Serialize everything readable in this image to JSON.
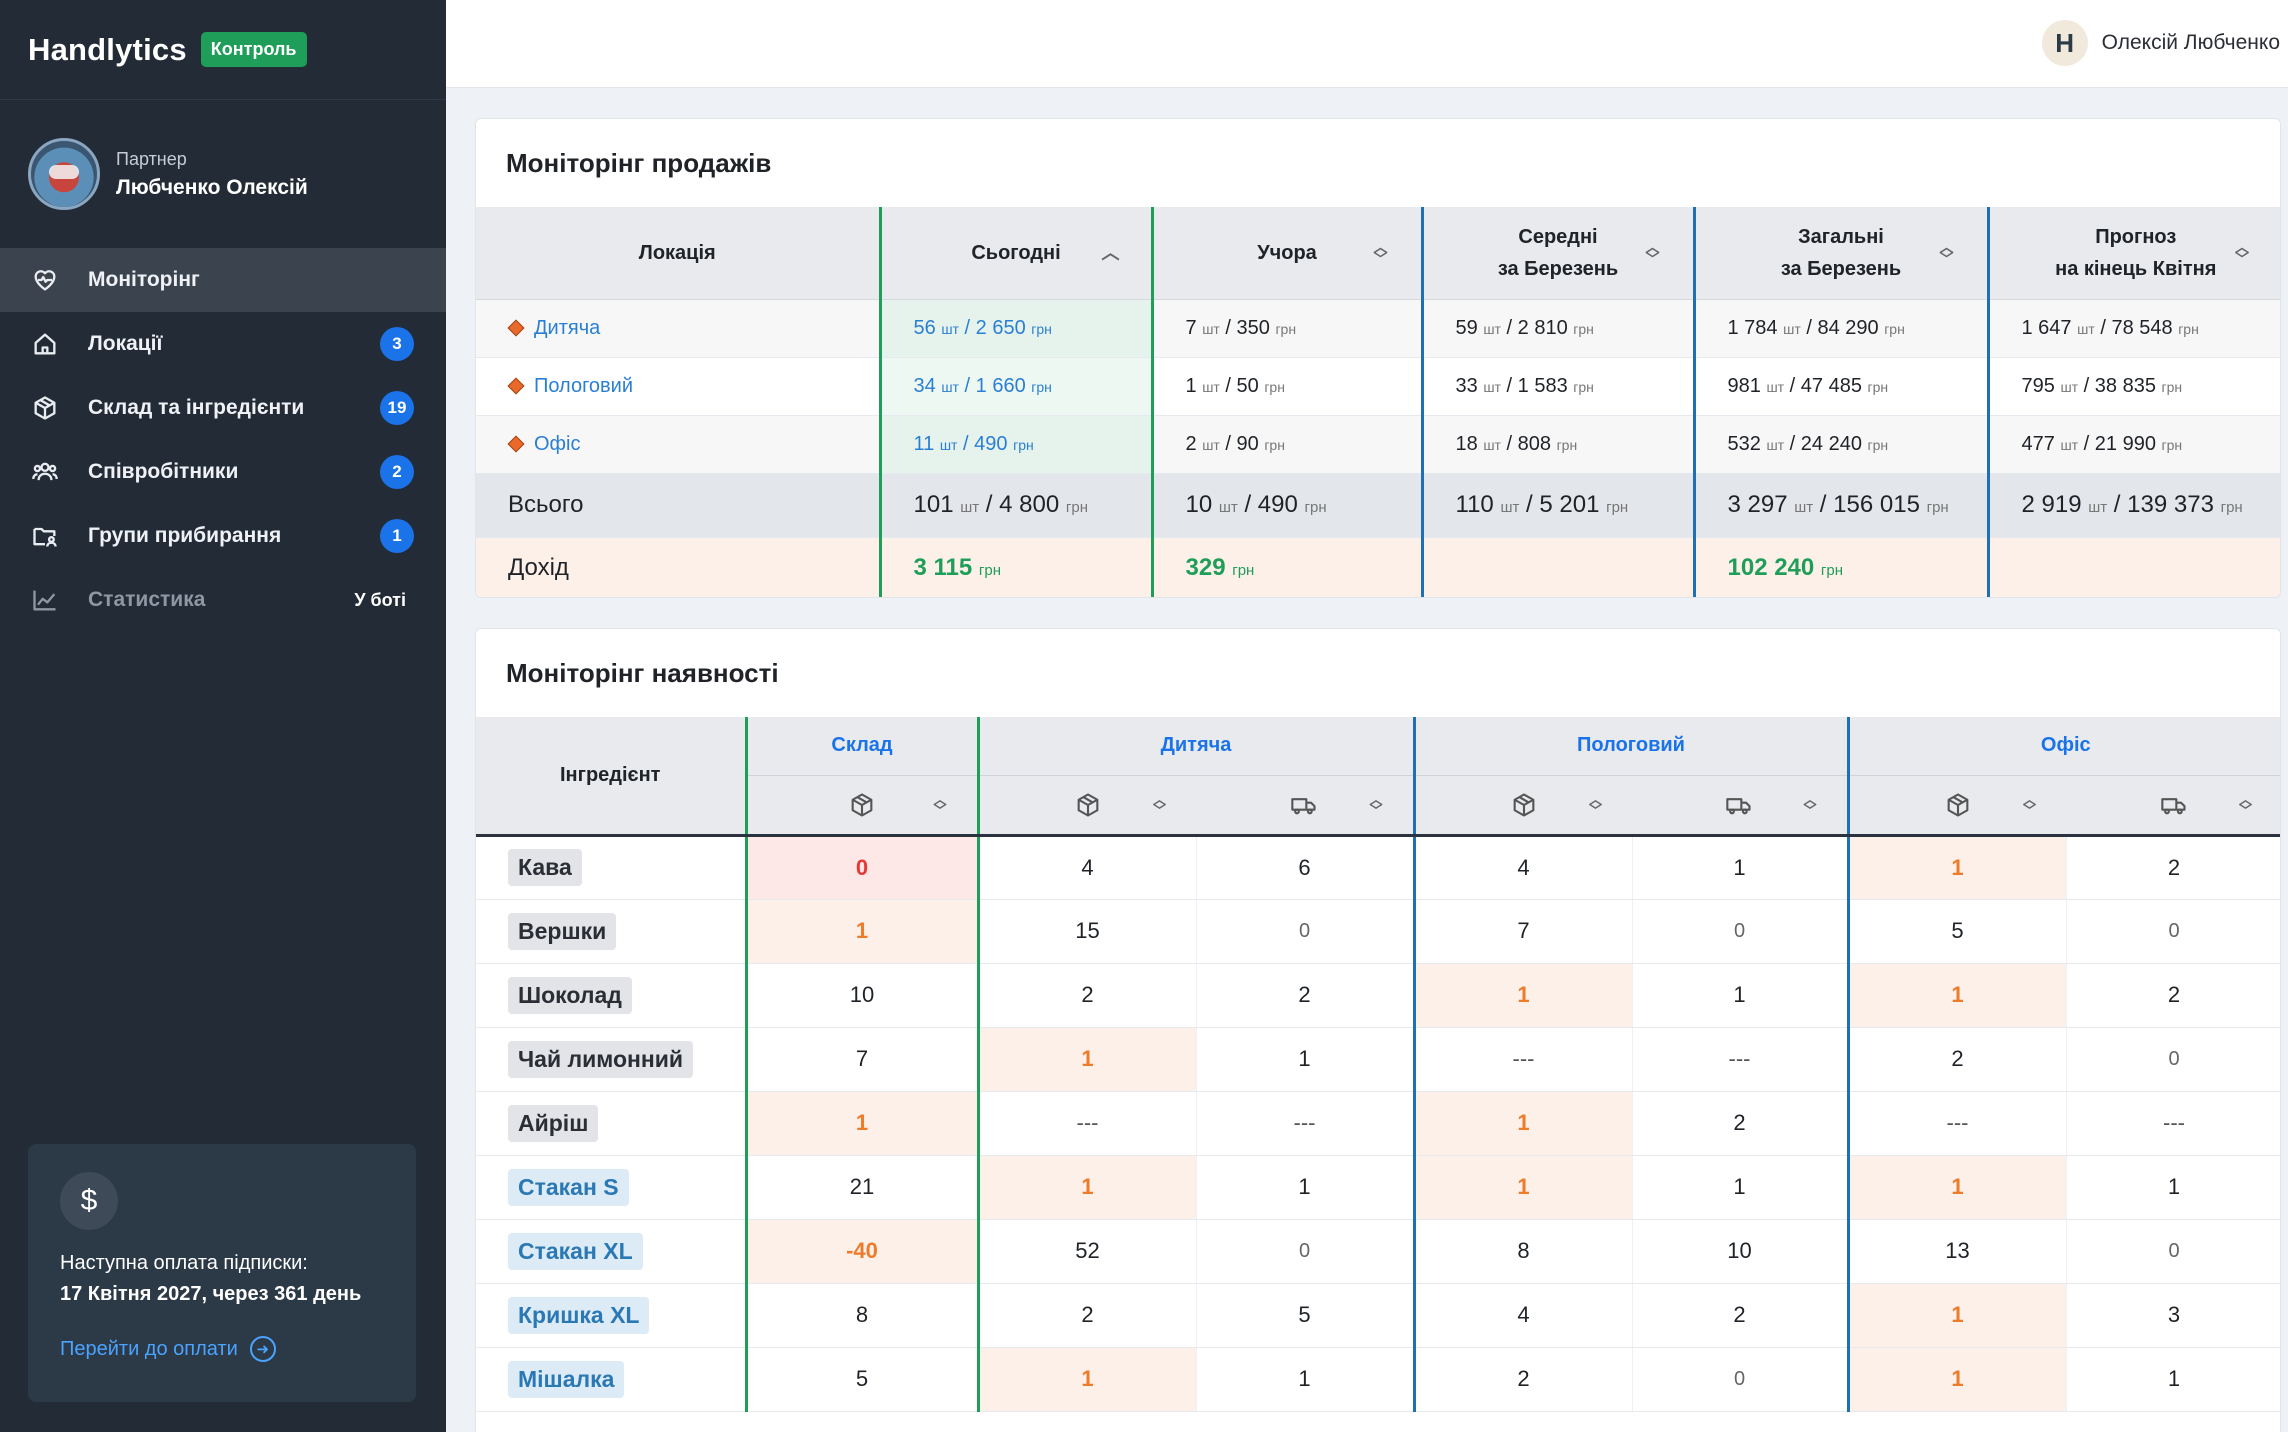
{
  "brand": {
    "name": "Handlytics",
    "badge": "Контроль"
  },
  "profile": {
    "role": "Партнер",
    "name": "Любченко Олексій"
  },
  "nav": [
    {
      "label": "Моніторінг",
      "icon": "heart-pulse-icon",
      "badge": "",
      "active": true
    },
    {
      "label": "Локації",
      "icon": "home-icon",
      "badge": "3"
    },
    {
      "label": "Склад та інгредієнти",
      "icon": "box-icon",
      "badge": "19"
    },
    {
      "label": "Співробітники",
      "icon": "users-icon",
      "badge": "2"
    },
    {
      "label": "Групи прибирання",
      "icon": "folder-user-icon",
      "badge": "1"
    },
    {
      "label": "Статистика",
      "icon": "chart-line-icon",
      "tag": "У боті"
    }
  ],
  "payment": {
    "icon": "$",
    "line1": "Наступна оплата підписки:",
    "line2": "17 Квітня 2027, через 361 день",
    "link": "Перейти до оплати"
  },
  "user": {
    "logo": "H",
    "name": "Олексій Любченко"
  },
  "sales": {
    "title": "Моніторінг продажів",
    "headers": {
      "location": "Локація",
      "today": "Сьогодні",
      "yesterday": "Учора",
      "avg_l1": "Середні",
      "avg_l2": "за Березень",
      "total_l1": "Загальні",
      "total_l2": "за Березень",
      "forecast_l1": "Прогноз",
      "forecast_l2": "на кінець Квітня"
    },
    "unit_pcs": "шт",
    "unit_uah": "грн",
    "rows": [
      {
        "name": "Дитяча",
        "today": [
          "56",
          "2 650"
        ],
        "yesterday": [
          "7",
          "350"
        ],
        "avg": [
          "59",
          "2 810"
        ],
        "total": [
          "1 784",
          "84 290"
        ],
        "forecast": [
          "1 647",
          "78 548"
        ]
      },
      {
        "name": "Пологовий",
        "today": [
          "34",
          "1 660"
        ],
        "yesterday": [
          "1",
          "50"
        ],
        "avg": [
          "33",
          "1 583"
        ],
        "total": [
          "981",
          "47 485"
        ],
        "forecast": [
          "795",
          "38 835"
        ]
      },
      {
        "name": "Офіс",
        "today": [
          "11",
          "490"
        ],
        "yesterday": [
          "2",
          "90"
        ],
        "avg": [
          "18",
          "808"
        ],
        "total": [
          "532",
          "24 240"
        ],
        "forecast": [
          "477",
          "21 990"
        ]
      }
    ],
    "total": {
      "label": "Всього",
      "today": [
        "101",
        "4 800"
      ],
      "yesterday": [
        "10",
        "490"
      ],
      "avg": [
        "110",
        "5 201"
      ],
      "total": [
        "3 297",
        "156 015"
      ],
      "forecast": [
        "2 919",
        "139 373"
      ]
    },
    "income": {
      "label": "Дохід",
      "today": "3 115",
      "yesterday": "329",
      "total": "102 240"
    }
  },
  "stock": {
    "title": "Моніторінг наявності",
    "ingredient_header": "Інгредієнт",
    "groups": [
      "Склад",
      "Дитяча",
      "Пологовий",
      "Офіс"
    ],
    "rows": [
      {
        "name": "Кава",
        "chip": "gray",
        "cells": [
          "0",
          "4",
          "6",
          "4",
          "1",
          "1",
          "2"
        ],
        "state": [
          "bad",
          "",
          "",
          "",
          "",
          "warn",
          ""
        ]
      },
      {
        "name": "Вершки",
        "chip": "gray",
        "cells": [
          "1",
          "15",
          "0",
          "7",
          "0",
          "5",
          "0"
        ],
        "state": [
          "warn",
          "",
          "zero",
          "",
          "zero",
          "",
          "zero"
        ]
      },
      {
        "name": "Шоколад",
        "chip": "gray",
        "cells": [
          "10",
          "2",
          "2",
          "1",
          "1",
          "1",
          "2"
        ],
        "state": [
          "",
          "",
          "",
          "warn",
          "",
          "warn",
          ""
        ]
      },
      {
        "name": "Чай лимонний",
        "chip": "gray",
        "cells": [
          "7",
          "1",
          "1",
          "---",
          "---",
          "2",
          "0"
        ],
        "state": [
          "",
          "warn",
          "",
          "dash",
          "dash",
          "",
          "zero"
        ]
      },
      {
        "name": "Айріш",
        "chip": "gray",
        "cells": [
          "1",
          "---",
          "---",
          "1",
          "2",
          "---",
          "---"
        ],
        "state": [
          "warn",
          "dash",
          "dash",
          "warn",
          "",
          "dash",
          "dash"
        ]
      },
      {
        "name": "Стакан S",
        "chip": "blue",
        "cells": [
          "21",
          "1",
          "1",
          "1",
          "1",
          "1",
          "1"
        ],
        "state": [
          "",
          "warn",
          "",
          "warn",
          "",
          "warn",
          ""
        ]
      },
      {
        "name": "Стакан XL",
        "chip": "blue",
        "cells": [
          "-40",
          "52",
          "0",
          "8",
          "10",
          "13",
          "0"
        ],
        "state": [
          "warn",
          "",
          "zero",
          "",
          "",
          "",
          "zero"
        ]
      },
      {
        "name": "Кришка XL",
        "chip": "blue",
        "cells": [
          "8",
          "2",
          "5",
          "4",
          "2",
          "1",
          "3"
        ],
        "state": [
          "",
          "",
          "",
          "",
          "",
          "warn",
          ""
        ]
      },
      {
        "name": "Мішалка",
        "chip": "blue",
        "cells": [
          "5",
          "1",
          "1",
          "2",
          "0",
          "1",
          "1"
        ],
        "state": [
          "",
          "warn",
          "",
          "",
          "zero",
          "warn",
          ""
        ]
      }
    ]
  }
}
